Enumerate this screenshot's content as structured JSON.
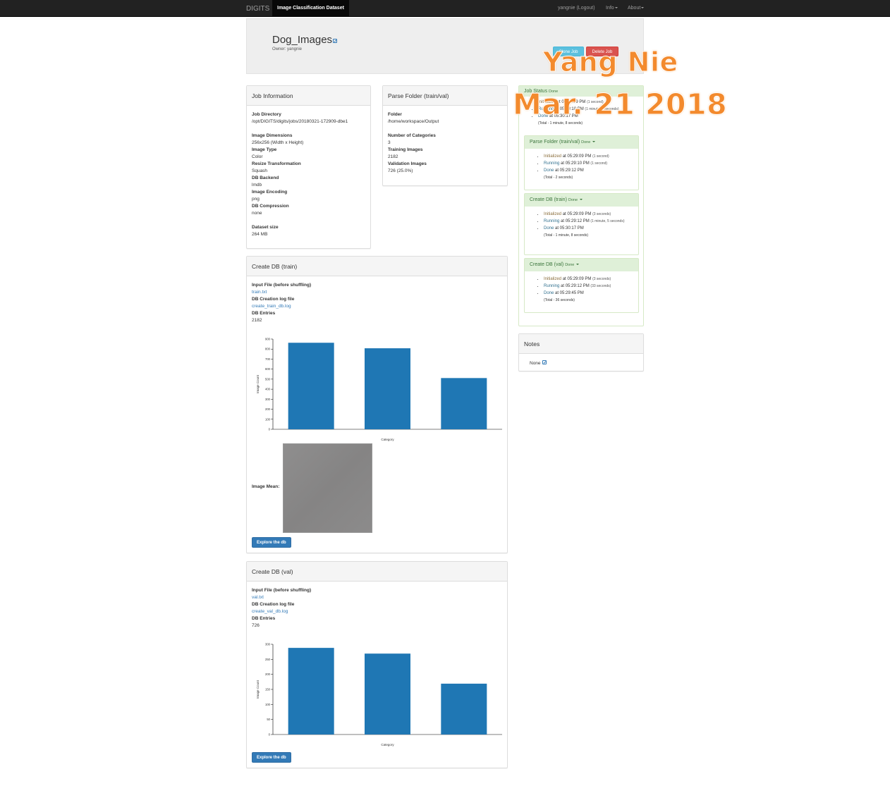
{
  "navbar": {
    "brand": "DIGITS",
    "active_tab": "Image Classification Dataset",
    "user": "yangnie (Logout)",
    "info": "Info",
    "about": "About"
  },
  "job": {
    "title": "Dog_Images",
    "owner": "Owner: yangnie",
    "clone_label": "Clone Job",
    "delete_label": "Delete Job"
  },
  "job_info": {
    "heading": "Job Information",
    "fields": [
      {
        "label": "Job Directory",
        "value": "/opt/DIGITS/digits/jobs/20180321-172909-dbe1"
      },
      {
        "label": "Image Dimensions",
        "value": "256x256 (Width x Height)"
      },
      {
        "label": "Image Type",
        "value": "Color"
      },
      {
        "label": "Resize Transformation",
        "value": "Squash"
      },
      {
        "label": "DB Backend",
        "value": "lmdb"
      },
      {
        "label": "Image Encoding",
        "value": "png"
      },
      {
        "label": "DB Compression",
        "value": "none"
      },
      {
        "label": "Dataset size",
        "value": "264 MB"
      }
    ]
  },
  "parse_folder": {
    "heading": "Parse Folder (train/val)",
    "fields": [
      {
        "label": "Folder",
        "value": "/home/workspace/Output"
      },
      {
        "label": "Number of Categories",
        "value": "3"
      },
      {
        "label": "Training Images",
        "value": "2182"
      },
      {
        "label": "Validation Images",
        "value": "726 (25.0%)"
      }
    ]
  },
  "create_db_train": {
    "heading": "Create DB (train)",
    "input_label": "Input File (before shuffling)",
    "input_link": "train.txt",
    "log_label": "DB Creation log file",
    "log_link": "create_train_db.log",
    "entries_label": "DB Entries",
    "entries_value": "2182",
    "image_mean_label": "Image Mean:",
    "explore_label": "Explore the db"
  },
  "create_db_val": {
    "heading": "Create DB (val)",
    "input_label": "Input File (before shuffling)",
    "input_link": "val.txt",
    "log_label": "DB Creation log file",
    "log_link": "create_val_db.log",
    "entries_label": "DB Entries",
    "entries_value": "726",
    "explore_label": "Explore the db"
  },
  "chart_data": [
    {
      "type": "bar",
      "categories": [
        "",
        "",
        ""
      ],
      "values": [
        863,
        808,
        511
      ],
      "xlabel": "Category",
      "ylabel": "Image Count",
      "ylim": [
        0,
        900
      ],
      "yticks": [
        0,
        100,
        200,
        300,
        400,
        500,
        600,
        700,
        800,
        900
      ],
      "color": "#1f77b4"
    },
    {
      "type": "bar",
      "categories": [
        "",
        "",
        ""
      ],
      "values": [
        288,
        269,
        169
      ],
      "xlabel": "Category",
      "ylabel": "Image Count",
      "ylim": [
        0,
        300
      ],
      "yticks": [
        0,
        50,
        100,
        150,
        200,
        250,
        300
      ],
      "color": "#1f77b4"
    }
  ],
  "job_status": {
    "heading": "Job Status",
    "state": "Done",
    "events": [
      {
        "label": "Initialized",
        "time": "at 05:29:09 PM",
        "dur": "(1 second)"
      },
      {
        "label": "Running",
        "time": "at 05:29:10 PM",
        "dur": "(1 minute, 7 seconds)"
      },
      {
        "label": "Done",
        "time": "at 05:30:17 PM",
        "dur": ""
      }
    ],
    "total": "(Total - 1 minute, 8 seconds)"
  },
  "tasks": [
    {
      "heading": "Parse Folder (train/val)",
      "state": "Done",
      "events": [
        {
          "label": "Initialized",
          "time": "at 05:29:09 PM",
          "dur": "(1 second)"
        },
        {
          "label": "Running",
          "time": "at 05:29:10 PM",
          "dur": "(1 second)"
        },
        {
          "label": "Done",
          "time": "at 05:29:12 PM",
          "dur": ""
        }
      ],
      "total": "(Total - 2 seconds)"
    },
    {
      "heading": "Create DB (train)",
      "state": "Done",
      "events": [
        {
          "label": "Initialized",
          "time": "at 05:29:09 PM",
          "dur": "(3 seconds)"
        },
        {
          "label": "Running",
          "time": "at 05:29:12 PM",
          "dur": "(1 minute, 5 seconds)"
        },
        {
          "label": "Done",
          "time": "at 05:30:17 PM",
          "dur": ""
        }
      ],
      "total": "(Total - 1 minute, 8 seconds)"
    },
    {
      "heading": "Create DB (val)",
      "state": "Done",
      "events": [
        {
          "label": "Initialized",
          "time": "at 05:29:09 PM",
          "dur": "(3 seconds)"
        },
        {
          "label": "Running",
          "time": "at 05:29:12 PM",
          "dur": "(33 seconds)"
        },
        {
          "label": "Done",
          "time": "at 05:29:45 PM",
          "dur": ""
        }
      ],
      "total": "(Total - 36 seconds)"
    }
  ],
  "notes": {
    "heading": "Notes",
    "value": "None"
  },
  "watermark": {
    "name": "Yang Nie",
    "date": "Mar. 21 2018"
  }
}
